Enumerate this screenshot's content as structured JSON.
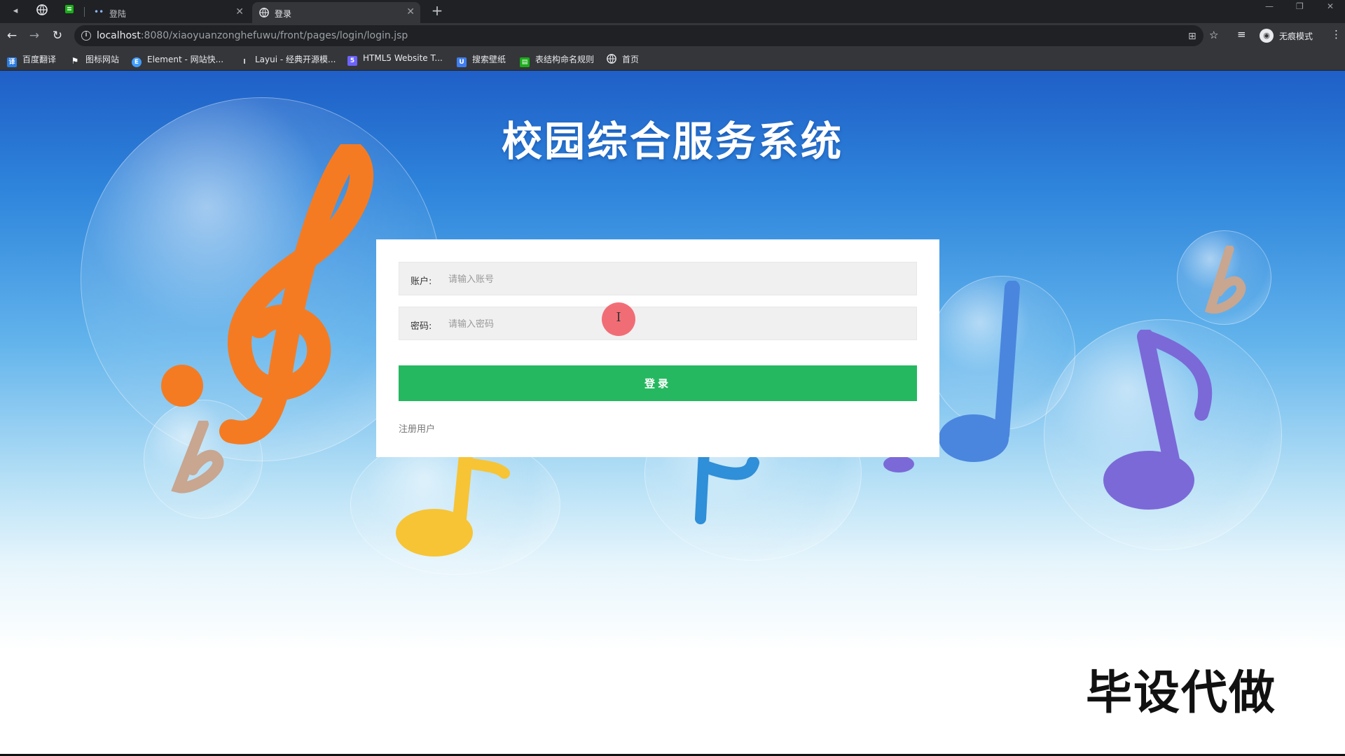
{
  "browser": {
    "tabs": [
      {
        "title": "登陆",
        "active": false
      },
      {
        "title": "登录",
        "active": true
      }
    ],
    "url_host": "localhost",
    "url_rest": ":8080/xiaoyuanzonghefuwu/front/pages/login/login.jsp",
    "profile_label": "无痕模式"
  },
  "bookmarks": [
    {
      "label": "百度翻译",
      "color": "#2b7de1",
      "icon": "translate-icon"
    },
    {
      "label": "图标网站",
      "color": "#ffffff",
      "icon": "flag-icon"
    },
    {
      "label": "Element - 网站快...",
      "color": "#409eff",
      "icon": "element-icon"
    },
    {
      "label": "Layui - 经典开源模...",
      "color": "#e8eaed",
      "icon": "layui-icon"
    },
    {
      "label": "HTML5 Website T...",
      "color": "#6c63ff",
      "icon": "html5-icon"
    },
    {
      "label": "搜索壁纸",
      "color": "#3f7ef0",
      "icon": "wallpaper-icon"
    },
    {
      "label": "表结构命名规则",
      "color": "#1aad19",
      "icon": "sheet-icon"
    },
    {
      "label": "首页",
      "color": "#e8eaed",
      "icon": "globe-icon"
    }
  ],
  "page": {
    "title": "校园综合服务系统",
    "login": {
      "account_label": "账户:",
      "account_placeholder": "请输入账号",
      "password_label": "密码:",
      "password_placeholder": "请输入密码",
      "submit_label": "登录",
      "register_label": "注册用户"
    },
    "watermark": "毕设代做"
  },
  "colors": {
    "login_button": "#25b860",
    "background_top": "#1f5fc7",
    "background_bottom": "#ffffff"
  }
}
